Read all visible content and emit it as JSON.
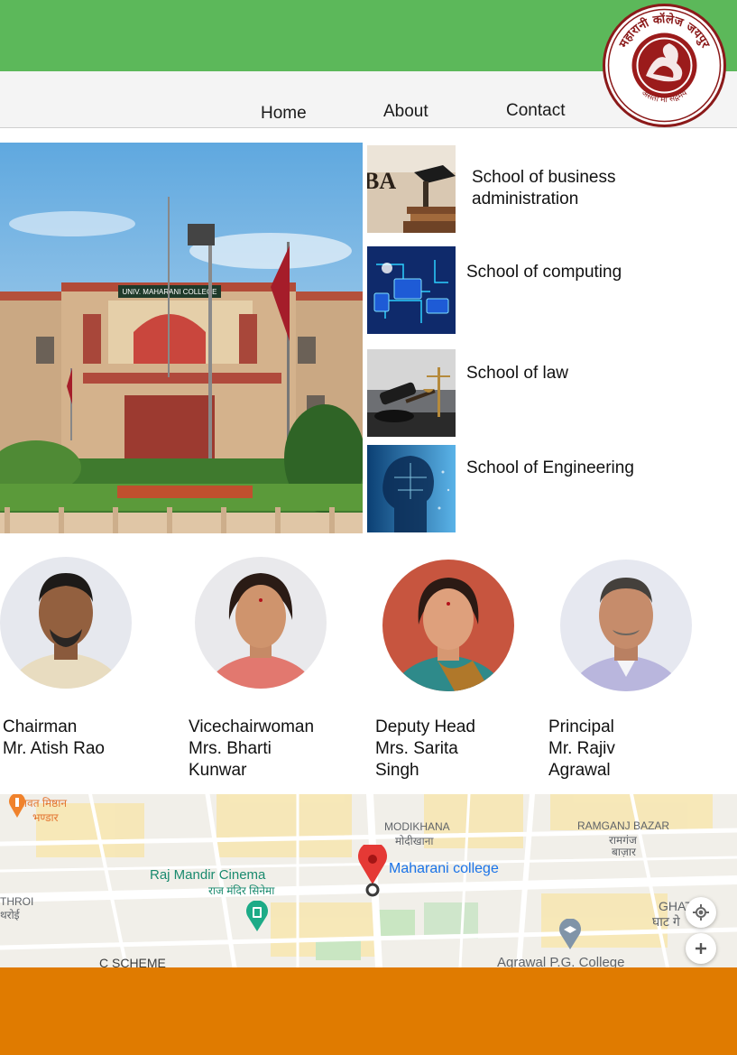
{
  "colors": {
    "header_green": "#5cb85a",
    "footer_orange": "#e07b00",
    "nav_bg": "#f4f4f4",
    "logo_red": "#8b1a1a"
  },
  "logo": {
    "top_text": "महारानी कॉलेज जयपुर",
    "bottom_text": "असतो मा सद्गमय"
  },
  "nav": {
    "home": "Home",
    "about": "About",
    "contact": "Contact"
  },
  "campus": {
    "sign": "UNIV. MAHARANI COLLEGE"
  },
  "schools": [
    {
      "label": "School of business administration",
      "icon": "bba-thumbnail",
      "thumb_text": "BA"
    },
    {
      "label": "School of computing",
      "icon": "computing-thumbnail"
    },
    {
      "label": "School of law",
      "icon": "law-gavel-thumbnail"
    },
    {
      "label": "School of Engineering",
      "icon": "engineering-ai-thumbnail"
    }
  ],
  "people": [
    {
      "role": "Chairman",
      "name": "Mr. Atish Rao"
    },
    {
      "role": "Vicechairwoman",
      "name": "Mrs. Bharti Kunwar"
    },
    {
      "role": "Deputy Head",
      "name": "Mrs. Sarita Singh"
    },
    {
      "role": "Principal",
      "name": "Mr. Rajiv Agrawal"
    }
  ],
  "map": {
    "marker_label": "Maharani college",
    "labels": {
      "rawat_hi": "रावत मिष्ठान",
      "rawat_hi2": "भण्डार",
      "modikhana": "MODIKHANA",
      "modikhana_hi": "मोदीखाना",
      "ramganj": "RAMGANJ BAZAR",
      "ramganj_hi": "रामगंज",
      "ramganj_hi2": "बाज़ार",
      "raj_mandir": "Raj Mandir Cinema",
      "raj_mandir_hi": "राज मंदिर सिनेमा",
      "throi": "THROI",
      "throi_hi": "थरोई",
      "ghat": "GHAT G",
      "ghat_hi": "घाट गे",
      "c_scheme": "C SCHEME",
      "agrawal": "Agrawal P.G. College"
    },
    "controls": {
      "locate_icon": "my-location-icon",
      "zoom_in_icon": "plus-icon"
    }
  }
}
